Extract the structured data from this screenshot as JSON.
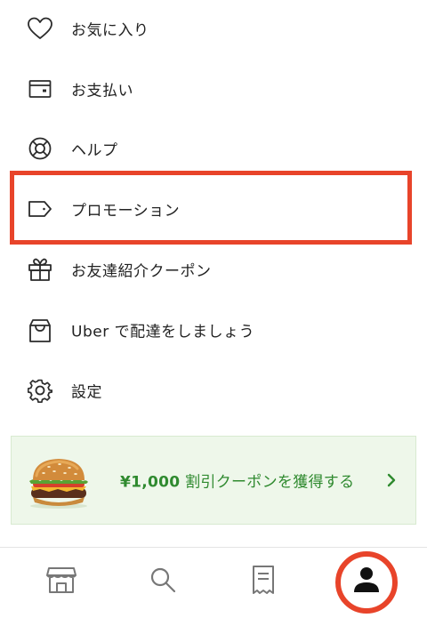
{
  "menu": {
    "items": [
      {
        "label": "お気に入り",
        "icon": "heart-icon"
      },
      {
        "label": "お支払い",
        "icon": "wallet-icon"
      },
      {
        "label": "ヘルプ",
        "icon": "lifebuoy-icon"
      },
      {
        "label": "プロモーション",
        "icon": "tag-icon"
      },
      {
        "label": "お友達紹介クーポン",
        "icon": "gift-icon"
      },
      {
        "label": "Uber で配達をしましょう",
        "icon": "shopping-bag-icon"
      },
      {
        "label": "設定",
        "icon": "gear-icon"
      }
    ]
  },
  "promo_banner": {
    "amount": "¥1,000",
    "text": " 割引クーポンを獲得する",
    "image": "burger-image",
    "chevron": "chevron-right-icon"
  },
  "bottom_nav": {
    "items": [
      {
        "name": "home",
        "icon": "store-icon"
      },
      {
        "name": "search",
        "icon": "search-icon"
      },
      {
        "name": "orders",
        "icon": "receipt-icon"
      },
      {
        "name": "account",
        "icon": "person-icon"
      }
    ]
  },
  "colors": {
    "highlight": "#e8442a",
    "promo_green": "#2f8a2f",
    "promo_bg": "#eef7ea",
    "icon_gray": "#777777",
    "text": "#222222"
  }
}
